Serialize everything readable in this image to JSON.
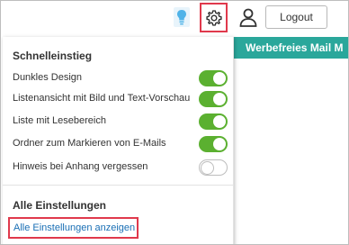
{
  "header": {
    "logout_label": "Logout",
    "icons": [
      "lightbulb-icon",
      "gear-icon",
      "user-icon"
    ],
    "accent_color": "#e0394c"
  },
  "side_banner": {
    "label": "Werbefreies Mail M",
    "color": "#2aa79b"
  },
  "quick_settings": {
    "title": "Schnelleinstieg",
    "items": [
      {
        "label": "Dunkles Design",
        "enabled": true
      },
      {
        "label": "Listenansicht mit Bild und Text-Vorschau",
        "enabled": true
      },
      {
        "label": "Liste mit Lesebereich",
        "enabled": true
      },
      {
        "label": "Ordner zum Markieren von E-Mails",
        "enabled": true
      },
      {
        "label": "Hinweis bei Anhang vergessen",
        "enabled": false
      }
    ],
    "toggle_on_color": "#5bb030"
  },
  "all_settings": {
    "title": "Alle Einstellungen",
    "link_label": "Alle Einstellungen anzeigen",
    "link_color": "#1a6fb5"
  }
}
